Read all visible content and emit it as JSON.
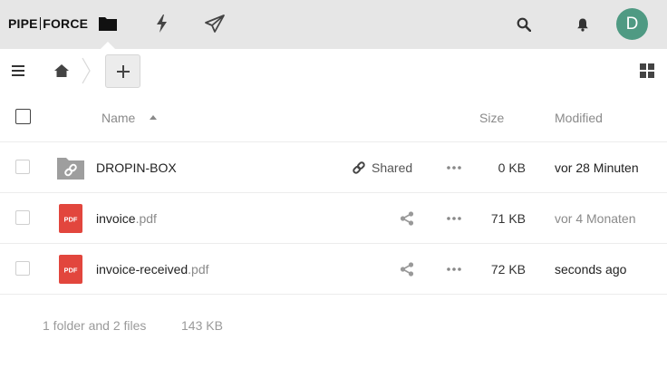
{
  "header": {
    "logo_left": "PIPE",
    "logo_right": "FORCE",
    "apps": [
      {
        "name": "files",
        "icon": "folder-icon",
        "active": true
      },
      {
        "name": "flows",
        "icon": "lightning-icon",
        "active": false
      },
      {
        "name": "send",
        "icon": "paper-plane-icon",
        "active": false
      }
    ],
    "avatar_letter": "D",
    "avatar_color": "#4f9a83"
  },
  "controls": {
    "add_label": "+"
  },
  "table": {
    "columns": {
      "name": "Name",
      "size": "Size",
      "modified": "Modified"
    },
    "rows": [
      {
        "type": "folder",
        "icon": "shared-folder-icon",
        "name": "DROPIN-BOX",
        "ext": "",
        "shared_label": "Shared",
        "size": "0 KB",
        "modified": "vor 28 Minuten"
      },
      {
        "type": "pdf",
        "icon": "pdf-icon",
        "icon_label": "PDF",
        "name": "invoice",
        "ext": ".pdf",
        "size": "71 KB",
        "modified": "vor 4 Monaten"
      },
      {
        "type": "pdf",
        "icon": "pdf-icon",
        "icon_label": "PDF",
        "name": "invoice-received",
        "ext": ".pdf",
        "size": "72 KB",
        "modified": "seconds ago"
      }
    ]
  },
  "summary": {
    "counts": "1 folder and 2 files",
    "total_size": "143 KB"
  },
  "colors": {
    "header_bg": "#e6e6e6",
    "pdf_red": "#e2463d",
    "folder_gray": "#9e9e9e"
  }
}
